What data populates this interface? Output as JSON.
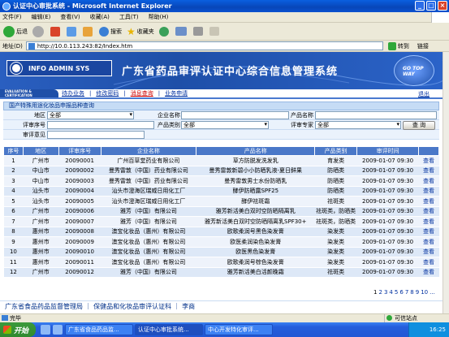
{
  "window": {
    "title": "认证中心审批系统 - Microsoft Internet Explorer"
  },
  "menu": [
    "文件(F)",
    "编辑(E)",
    "查看(V)",
    "收藏(A)",
    "工具(T)",
    "帮助(H)"
  ],
  "toolbar": {
    "back": "后退",
    "search": "搜索",
    "favorites": "收藏夹"
  },
  "address": {
    "label": "地址(D)",
    "value": "http://10.0.113.243:82/Index.htm",
    "go": "转到",
    "links": "链接"
  },
  "banner": {
    "logo_text": "INFO ADMIN SYS",
    "title": "广东省药品审评认证中心综合信息管理系统",
    "globe_text": "GO TOP WAY"
  },
  "nav": {
    "eval_logo": "EVALUATION & CERTIFICATION",
    "items": [
      "待办业务",
      "修改密码",
      "消息查询",
      "业务申请"
    ],
    "exit": "退出"
  },
  "section_title": "国产特殊用途化妆品申报品种查询",
  "form": {
    "region_label": "地区",
    "region_value": "全部",
    "company_label": "企业名称",
    "company_value": "",
    "product_label": "产品名称",
    "product_value": "",
    "review_no_label": "评审序号",
    "review_no_value": "",
    "category_label": "产品类别",
    "category_value": "全部",
    "expert_label": "评审专家",
    "expert_value": "全部",
    "opinion_label": "审评意见",
    "opinion_value": "",
    "query_button": "查 询"
  },
  "table": {
    "headers": [
      "序号",
      "地区",
      "评审序号",
      "企业名称",
      "产品名称",
      "产品类别",
      "审评时间",
      ""
    ],
    "rows": [
      [
        "1",
        "广州市",
        "20090001",
        "广州百草堂药业有限公司",
        "草方防脱发洗发乳",
        "育发类",
        "2009-01-07 09:30",
        "查看"
      ],
      [
        "2",
        "中山市",
        "20090002",
        "曼秀雷敦（中国）药业有限公司",
        "曼秀雷敦新碧小小防晒乳液-夏日鲜果",
        "防晒类",
        "2009-01-07 09:30",
        "查看"
      ],
      [
        "3",
        "中山市",
        "20090003",
        "曼秀雷敦（中国）药业有限公司",
        "曼秀雷敦男士水份防晒乳",
        "防晒类",
        "2009-01-07 09:30",
        "查看"
      ],
      [
        "4",
        "汕头市",
        "20090004",
        "汕头市澄海区瑞威日用化工厂",
        "酵伊防晒露SPF25",
        "防晒类",
        "2009-01-07 09:30",
        "查看"
      ],
      [
        "5",
        "汕头市",
        "20090005",
        "汕头市澄海区瑞威日用化工厂",
        "酵伊祛斑霜",
        "祛斑类",
        "2009-01-07 09:30",
        "查看"
      ],
      [
        "6",
        "广州市",
        "20090006",
        "雅芳（中国）有限公司",
        "雅芳新活美白双时空防晒隔离乳",
        "祛斑类，防晒类",
        "2009-01-07 09:30",
        "查看"
      ],
      [
        "7",
        "广州市",
        "20090007",
        "雅芳（中国）有限公司",
        "雅芳新活美白双时空防晒隔离乳SPF30+",
        "祛斑类，防晒类",
        "2009-01-07 09:30",
        "查看"
      ],
      [
        "8",
        "惠州市",
        "20090008",
        "澳宝化妆品（惠州）有限公司",
        "欧歌柔润号黑色染发膏",
        "染发类",
        "2009-01-07 09:30",
        "查看"
      ],
      [
        "9",
        "惠州市",
        "20090009",
        "澳宝化妆品（惠州）有限公司",
        "欧医柔润染色染发膏",
        "染发类",
        "2009-01-07 09:30",
        "查看"
      ],
      [
        "10",
        "惠州市",
        "20090010",
        "澳宝化妆品（惠州）有限公司",
        "欧医黑色染发膏",
        "染发类",
        "2009-01-07 09:30",
        "查看"
      ],
      [
        "11",
        "惠州市",
        "20090011",
        "澳宝化妆品（惠州）有限公司",
        "欧歌柔润号棕色染发膏",
        "染发类",
        "2009-01-07 09:30",
        "查看"
      ],
      [
        "12",
        "广州市",
        "20090012",
        "雅芳（中国）有限公司",
        "雅芳新活美白活颜晚霜",
        "祛斑类",
        "2009-01-07 09:30",
        "查看"
      ]
    ]
  },
  "pager": {
    "pages": [
      "1",
      "2",
      "3",
      "4",
      "5",
      "6",
      "7",
      "8",
      "9",
      "10",
      "..."
    ],
    "current": "1"
  },
  "footer": {
    "text": "广东省食品药品监督管理局 ｜ 保健品和化妆品审评认证科 ｜ 李商"
  },
  "status": {
    "left": "完毕",
    "zone": "可信站点"
  },
  "taskbar": {
    "start": "开始",
    "tasks": [
      "广东省食品药品监...",
      "认证中心审批系统...",
      "中心开发特化审评..."
    ],
    "clock": "16:25"
  }
}
